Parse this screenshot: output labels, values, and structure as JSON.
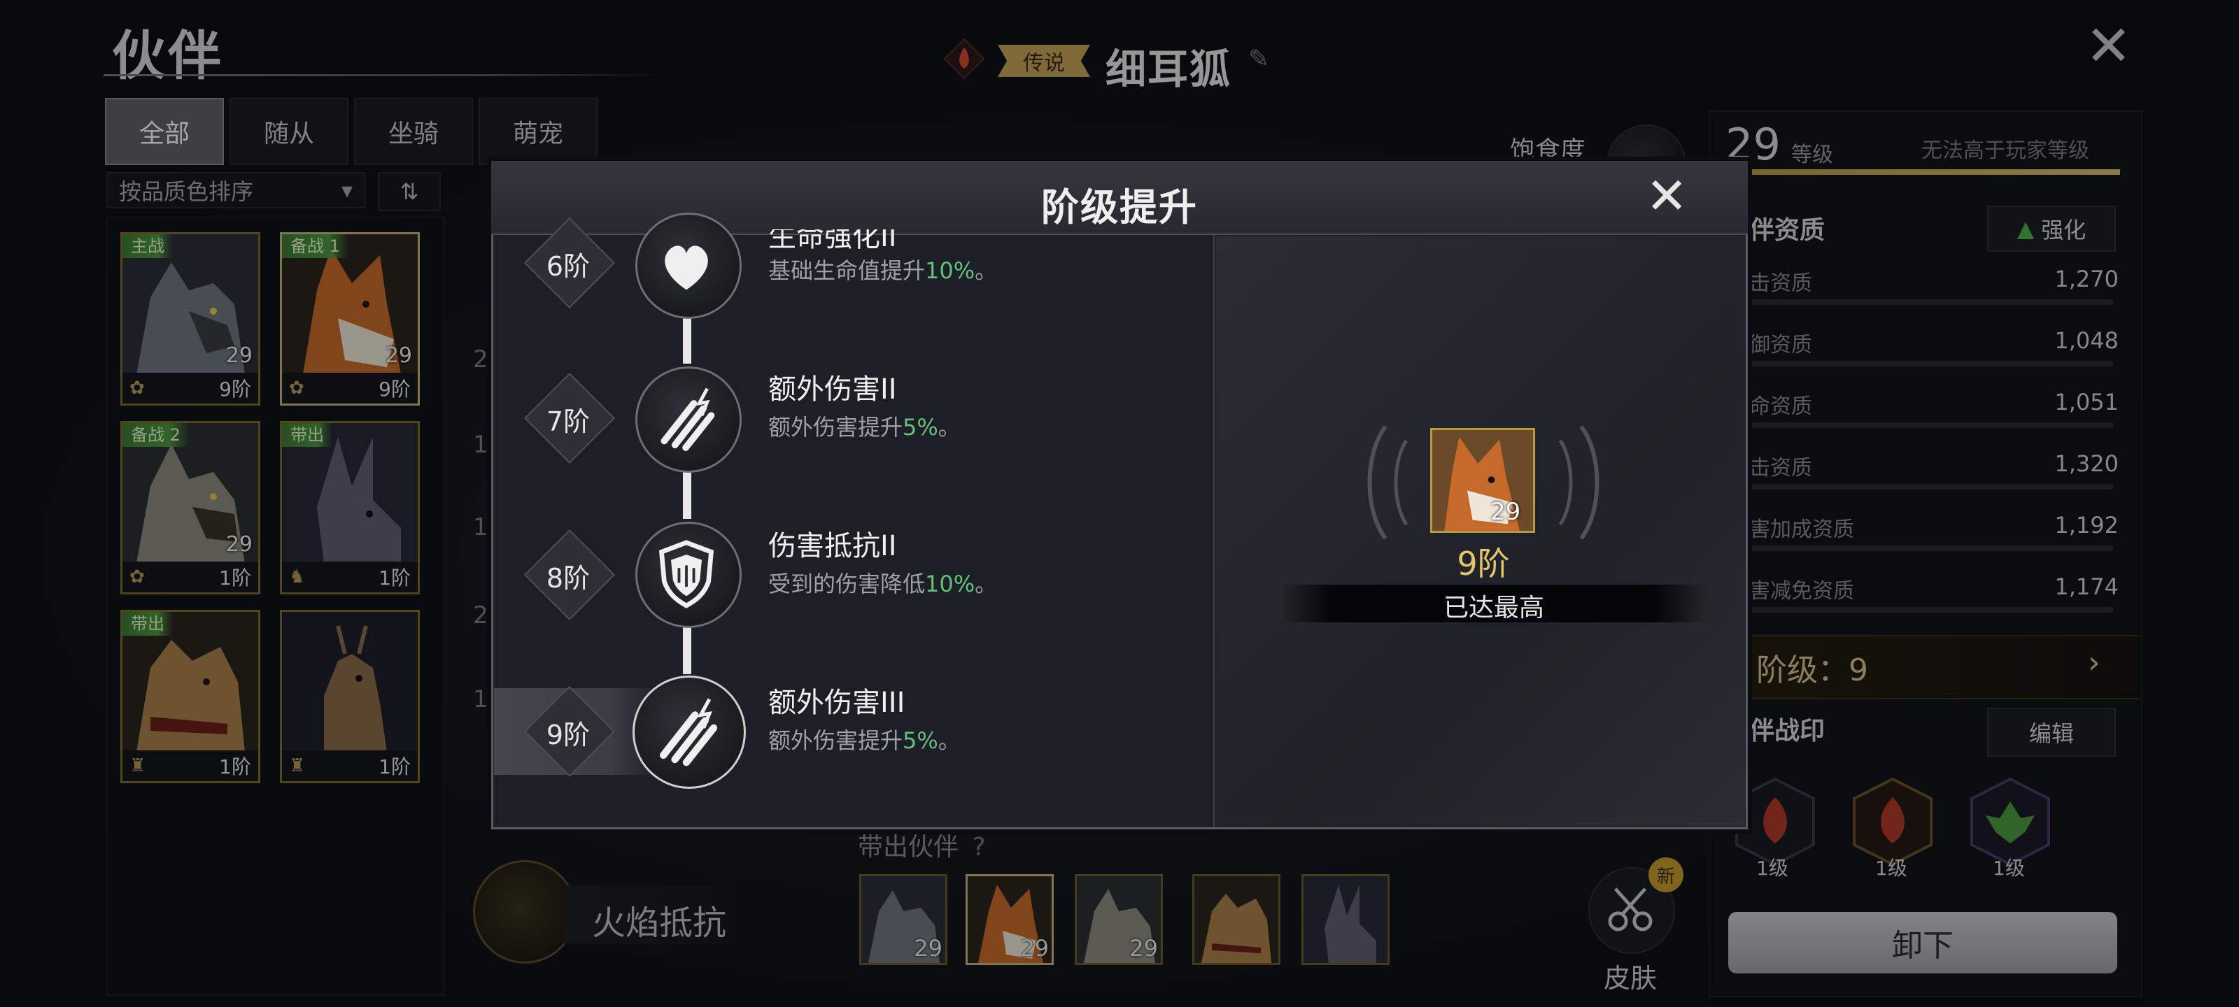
{
  "left": {
    "title": "伙伴",
    "tabs": [
      "全部",
      "随从",
      "坐骑",
      "萌宠"
    ],
    "sort_label": "按品质色排序",
    "sort_icon": "swap-arrows-icon",
    "cards": [
      {
        "badge": "主战",
        "level": "29",
        "tier": "9阶",
        "animal": "wolf"
      },
      {
        "badge": "备战 1",
        "level": "29",
        "tier": "9阶",
        "animal": "fox"
      },
      {
        "badge": "备战 2",
        "level": "29",
        "tier": "1阶",
        "animal": "wolf"
      },
      {
        "badge": "带出",
        "level": "",
        "tier": "1阶",
        "animal": "rabbit"
      },
      {
        "badge": "带出",
        "level": "",
        "tier": "1阶",
        "animal": "lynx"
      },
      {
        "badge": "",
        "level": "",
        "tier": "1阶",
        "animal": "deer"
      }
    ]
  },
  "header": {
    "rarity": "传说",
    "name": "细耳狐",
    "satiety_label": "饱食度",
    "close_icon": "close-icon"
  },
  "behind_stubs": [
    "2",
    "1",
    "1",
    "2",
    "1"
  ],
  "right": {
    "level": "29",
    "level_unit": "等级",
    "level_note": "无法高于玩家等级",
    "aptitude_title": "伴资质",
    "enhance_label": "强化",
    "stats": [
      {
        "label": "击资质",
        "value": "1,270"
      },
      {
        "label": "御资质",
        "value": "1,048"
      },
      {
        "label": "命资质",
        "value": "1,051"
      },
      {
        "label": "击资质",
        "value": "1,320"
      },
      {
        "label": "害加成资质",
        "value": "1,192"
      },
      {
        "label": "害减免资质",
        "value": "1,174"
      }
    ],
    "rank_text": "阶级：9",
    "seal_title": "伴战印",
    "edit_label": "编辑",
    "seals": [
      {
        "level": "1级",
        "color": "#b03a2a"
      },
      {
        "level": "1级",
        "color": "#b03a2a"
      },
      {
        "level": "1级",
        "color": "#4a9a3f"
      }
    ],
    "unload_label": "卸下"
  },
  "bottom": {
    "skill_name": "火焰抵抗",
    "bring_label": "带出伙伴",
    "help_icon": "question-icon",
    "thumbs": [
      {
        "level": "29",
        "animal": "wolf"
      },
      {
        "level": "29",
        "animal": "fox"
      },
      {
        "level": "29",
        "animal": "wolf"
      },
      {
        "level": "",
        "animal": "lynx"
      },
      {
        "level": "",
        "animal": "rabbit"
      }
    ],
    "skin_label": "皮肤",
    "skin_new": "新"
  },
  "modal": {
    "title": "阶级提升",
    "stages": [
      {
        "stage": "6阶",
        "name": "生命强化II",
        "desc_prefix": "基础生命值提升",
        "desc_value": "10%",
        "desc_suffix": "。",
        "icon": "heart-icon"
      },
      {
        "stage": "7阶",
        "name": "额外伤害II",
        "desc_prefix": "额外伤害提升",
        "desc_value": "5%",
        "desc_suffix": "。",
        "icon": "claw-icon"
      },
      {
        "stage": "8阶",
        "name": "伤害抵抗II",
        "desc_prefix": "受到的伤害降低",
        "desc_value": "10%",
        "desc_suffix": "。",
        "icon": "shield-icon"
      },
      {
        "stage": "9阶",
        "name": "额外伤害III",
        "desc_prefix": "额外伤害提升",
        "desc_value": "5%",
        "desc_suffix": "。",
        "icon": "claw-icon"
      }
    ],
    "preview": {
      "level": "29",
      "tier": "9阶",
      "status": "已达最高"
    }
  }
}
